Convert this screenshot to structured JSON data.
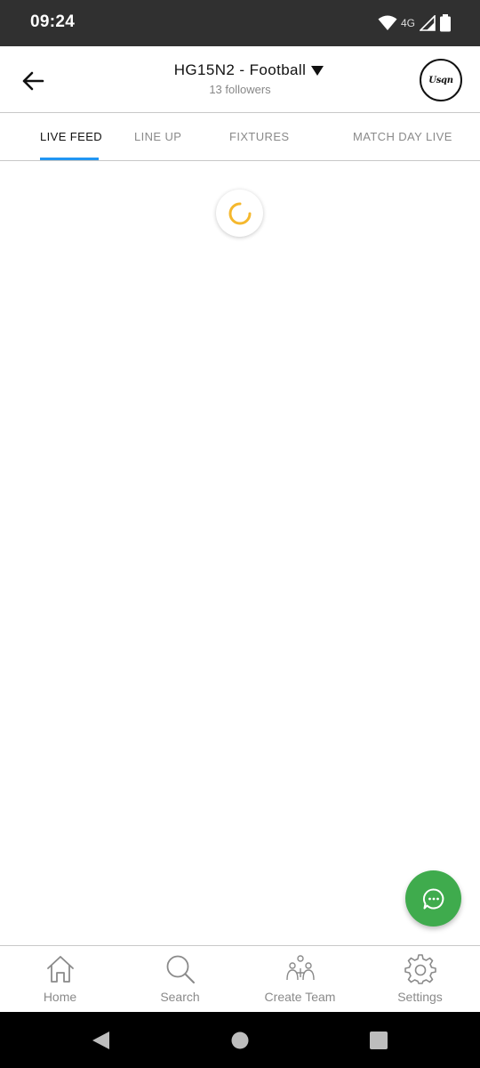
{
  "status_bar": {
    "time": "09:24",
    "network": "4G",
    "icons": [
      "wifi-icon",
      "cellular-signal-icon",
      "battery-icon"
    ]
  },
  "header": {
    "back_icon": "arrow-left-icon",
    "title": "HG15N2 - Football",
    "followers": "13 followers",
    "dropdown_icon": "caret-down-icon",
    "club_logo": "club-logo"
  },
  "tabs": [
    {
      "label": "LIVE FEED",
      "active": true
    },
    {
      "label": "LINE UP",
      "active": false
    },
    {
      "label": "FIXTURES",
      "active": false
    },
    {
      "label": "MATCH DAY LIVE",
      "active": false
    }
  ],
  "loader": {
    "icon": "loading-spinner-icon"
  },
  "fab": {
    "icon": "chat-bubble-icon"
  },
  "bottom_nav": [
    {
      "label": "Home",
      "icon": "home-icon"
    },
    {
      "label": "Search",
      "icon": "search-icon"
    },
    {
      "label": "Create Team",
      "icon": "create-team-icon"
    },
    {
      "label": "Settings",
      "icon": "gear-icon"
    }
  ],
  "colors": {
    "status_bar": "#303030",
    "tab_indicator": "#2196f3",
    "fab": "#3fab4d",
    "spinner": "#f5b82e",
    "system_nav": "#000000"
  }
}
